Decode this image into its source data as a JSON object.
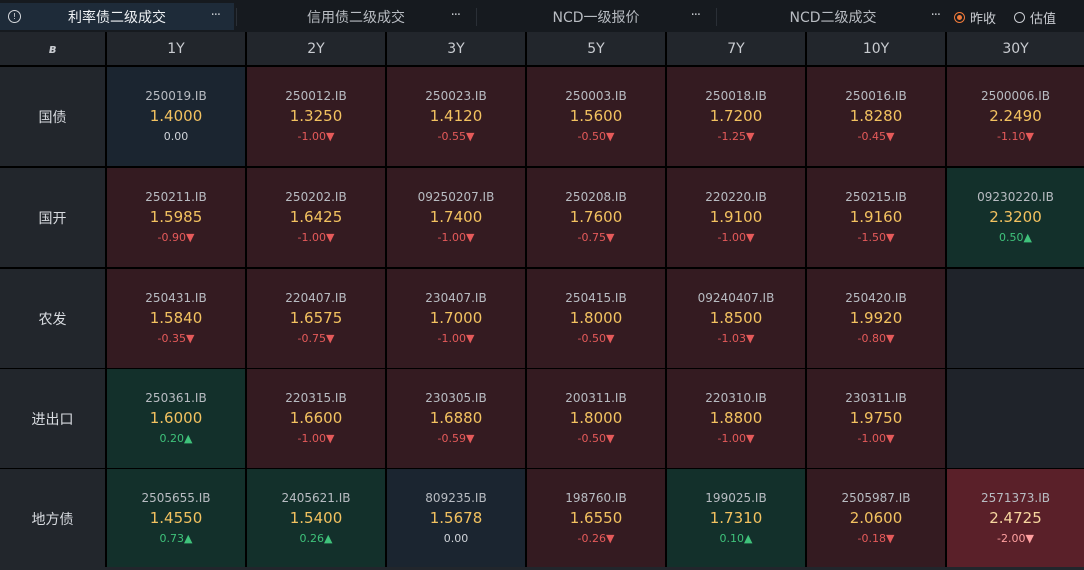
{
  "tabs": [
    {
      "label": "利率债二级成交",
      "active": true
    },
    {
      "label": "信用债二级成交",
      "active": false
    },
    {
      "label": "NCD一级报价",
      "active": false
    },
    {
      "label": "NCD二级成交",
      "active": false
    }
  ],
  "more_icon": "···",
  "radio_options": [
    {
      "label": "昨收",
      "selected": true
    },
    {
      "label": "估值",
      "selected": false
    }
  ],
  "corner_icon": "logo-icon",
  "corner_glyph": "ʙ",
  "columns": [
    "1Y",
    "2Y",
    "3Y",
    "5Y",
    "7Y",
    "10Y",
    "30Y"
  ],
  "colors": {
    "up": "#3fc27b",
    "down": "#e55a5a",
    "value": "#f3c260",
    "accent": "#f07a3a"
  },
  "rows": [
    {
      "label": "国债",
      "cells": [
        {
          "code": "250019.IB",
          "value": "1.4000",
          "change": "0.00",
          "dir": "flat"
        },
        {
          "code": "250012.IB",
          "value": "1.3250",
          "change": "-1.00▼",
          "dir": "down"
        },
        {
          "code": "250023.IB",
          "value": "1.4120",
          "change": "-0.55▼",
          "dir": "down"
        },
        {
          "code": "250003.IB",
          "value": "1.5600",
          "change": "-0.50▼",
          "dir": "down"
        },
        {
          "code": "250018.IB",
          "value": "1.7200",
          "change": "-1.25▼",
          "dir": "down"
        },
        {
          "code": "250016.IB",
          "value": "1.8280",
          "change": "-0.45▼",
          "dir": "down"
        },
        {
          "code": "2500006.IB",
          "value": "2.2490",
          "change": "-1.10▼",
          "dir": "down"
        }
      ]
    },
    {
      "label": "国开",
      "cells": [
        {
          "code": "250211.IB",
          "value": "1.5985",
          "change": "-0.90▼",
          "dir": "down"
        },
        {
          "code": "250202.IB",
          "value": "1.6425",
          "change": "-1.00▼",
          "dir": "down"
        },
        {
          "code": "09250207.IB",
          "value": "1.7400",
          "change": "-1.00▼",
          "dir": "down"
        },
        {
          "code": "250208.IB",
          "value": "1.7600",
          "change": "-0.75▼",
          "dir": "down"
        },
        {
          "code": "220220.IB",
          "value": "1.9100",
          "change": "-1.00▼",
          "dir": "down"
        },
        {
          "code": "250215.IB",
          "value": "1.9160",
          "change": "-1.50▼",
          "dir": "down"
        },
        {
          "code": "09230220.IB",
          "value": "2.3200",
          "change": "0.50▲",
          "dir": "up"
        }
      ]
    },
    {
      "label": "农发",
      "cells": [
        {
          "code": "250431.IB",
          "value": "1.5840",
          "change": "-0.35▼",
          "dir": "down"
        },
        {
          "code": "220407.IB",
          "value": "1.6575",
          "change": "-0.75▼",
          "dir": "down"
        },
        {
          "code": "230407.IB",
          "value": "1.7000",
          "change": "-1.00▼",
          "dir": "down"
        },
        {
          "code": "250415.IB",
          "value": "1.8000",
          "change": "-0.50▼",
          "dir": "down"
        },
        {
          "code": "09240407.IB",
          "value": "1.8500",
          "change": "-1.03▼",
          "dir": "down"
        },
        {
          "code": "250420.IB",
          "value": "1.9920",
          "change": "-0.80▼",
          "dir": "down"
        },
        {
          "code": "",
          "value": "",
          "change": "",
          "dir": "empty"
        }
      ]
    },
    {
      "label": "进出口",
      "cells": [
        {
          "code": "250361.IB",
          "value": "1.6000",
          "change": "0.20▲",
          "dir": "up"
        },
        {
          "code": "220315.IB",
          "value": "1.6600",
          "change": "-1.00▼",
          "dir": "down"
        },
        {
          "code": "230305.IB",
          "value": "1.6880",
          "change": "-0.59▼",
          "dir": "down"
        },
        {
          "code": "200311.IB",
          "value": "1.8000",
          "change": "-0.50▼",
          "dir": "down"
        },
        {
          "code": "220310.IB",
          "value": "1.8800",
          "change": "-1.00▼",
          "dir": "down"
        },
        {
          "code": "230311.IB",
          "value": "1.9750",
          "change": "-1.00▼",
          "dir": "down"
        },
        {
          "code": "",
          "value": "",
          "change": "",
          "dir": "empty"
        }
      ]
    },
    {
      "label": "地方债",
      "cells": [
        {
          "code": "2505655.IB",
          "value": "1.4550",
          "change": "0.73▲",
          "dir": "up"
        },
        {
          "code": "2405621.IB",
          "value": "1.5400",
          "change": "0.26▲",
          "dir": "up"
        },
        {
          "code": "809235.IB",
          "value": "1.5678",
          "change": "0.00",
          "dir": "flat"
        },
        {
          "code": "198760.IB",
          "value": "1.6550",
          "change": "-0.26▼",
          "dir": "down"
        },
        {
          "code": "199025.IB",
          "value": "1.7310",
          "change": "0.10▲",
          "dir": "up"
        },
        {
          "code": "2505987.IB",
          "value": "2.0600",
          "change": "-0.18▼",
          "dir": "down"
        },
        {
          "code": "2571373.IB",
          "value": "2.4725",
          "change": "-2.00▼",
          "dir": "hot"
        }
      ]
    }
  ]
}
